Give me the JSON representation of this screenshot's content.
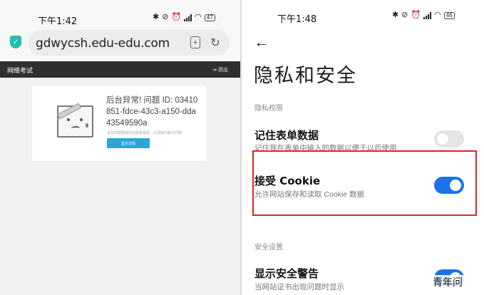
{
  "left_screen": {
    "status_bar": {
      "time": "下午1:42",
      "battery": "47"
    },
    "url_bar": {
      "url": "gdwycsh.edu-edu.com"
    },
    "site_header": {
      "title": "网络考试",
      "logout_label": "退出"
    },
    "error_card": {
      "message": "后台异常! 问题 ID: 03410851-fdce-43c3-a150-dda43549590a",
      "sub_text": "请及时截图保存后联系客服，以便我们解决问题",
      "detail_button": "显示详情"
    }
  },
  "right_screen": {
    "status_bar": {
      "time": "下午1:48",
      "battery": "46"
    },
    "page_title": "隐私和安全",
    "privacy_section": "隐私权限",
    "settings": [
      {
        "title": "记住表单数据",
        "description": "记住我在表单中输入的数据以便于以后使用",
        "enabled": false
      },
      {
        "title": "接受 Cookie",
        "description": "允许网站保存和读取 Cookie 数据",
        "enabled": true
      },
      {
        "title": "显示安全警告",
        "description": "当网站证书出现问题时显示",
        "enabled": true
      }
    ],
    "security_section": "安全设置"
  },
  "colors": {
    "toggle_on": "#1a73e8",
    "highlight_box": "#e02424",
    "shield": "#1fc0b0"
  },
  "watermark": "青年问"
}
